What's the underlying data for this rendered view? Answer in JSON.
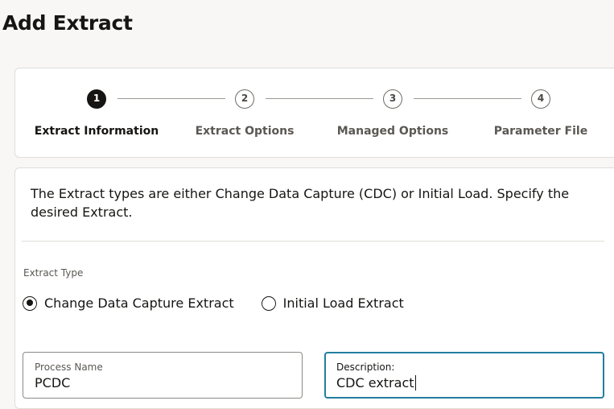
{
  "page": {
    "title": "Add Extract"
  },
  "train": {
    "steps": [
      {
        "number": "1",
        "label": "Extract Information",
        "state": "current"
      },
      {
        "number": "2",
        "label": "Extract Options",
        "state": "upcoming"
      },
      {
        "number": "3",
        "label": "Managed Options",
        "state": "upcoming"
      },
      {
        "number": "4",
        "label": "Parameter File",
        "state": "upcoming"
      }
    ]
  },
  "form": {
    "intro": "The Extract types are either Change Data Capture (CDC) or Initial Load. Specify the desired Extract.",
    "extract_type": {
      "label": "Extract Type",
      "options": [
        {
          "label": "Change Data Capture Extract",
          "selected": true
        },
        {
          "label": "Initial Load Extract",
          "selected": false
        }
      ]
    },
    "process_name": {
      "label": "Process Name",
      "value": "PCDC"
    },
    "description": {
      "label": "Description:",
      "value": "CDC extract",
      "focused": true
    }
  },
  "colors": {
    "active_step": "#161513",
    "focus_border": "#227e9e",
    "page_background": "#f8f7f5"
  }
}
